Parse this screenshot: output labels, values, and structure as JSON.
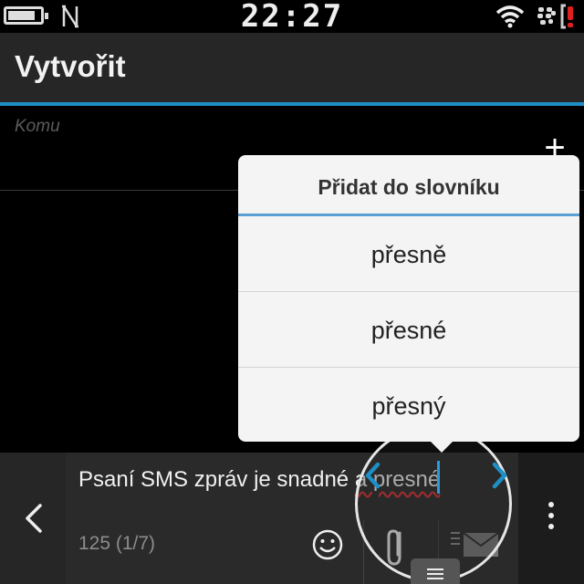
{
  "status_bar": {
    "time": "22:27",
    "battery_level": 0.85,
    "icons": [
      "battery-icon",
      "nfc-icon",
      "wifi-icon",
      "blackberry-icon",
      "notification-alert-icon"
    ]
  },
  "header": {
    "title": "Vytvořit"
  },
  "recipient": {
    "placeholder": "Komu",
    "add_label": "+"
  },
  "spell_popup": {
    "header": "Přidat do slovníku",
    "suggestions": [
      "přesně",
      "přesné",
      "přesný"
    ]
  },
  "compose": {
    "text_before": "Psaní SMS zpráv je snadné ",
    "misspelled_word": "a presné",
    "counter": "125 (1/7)"
  },
  "colors": {
    "accent": "#1e8fc6",
    "popup_accent": "#5a9fd4",
    "spell_error": "#d23030"
  }
}
